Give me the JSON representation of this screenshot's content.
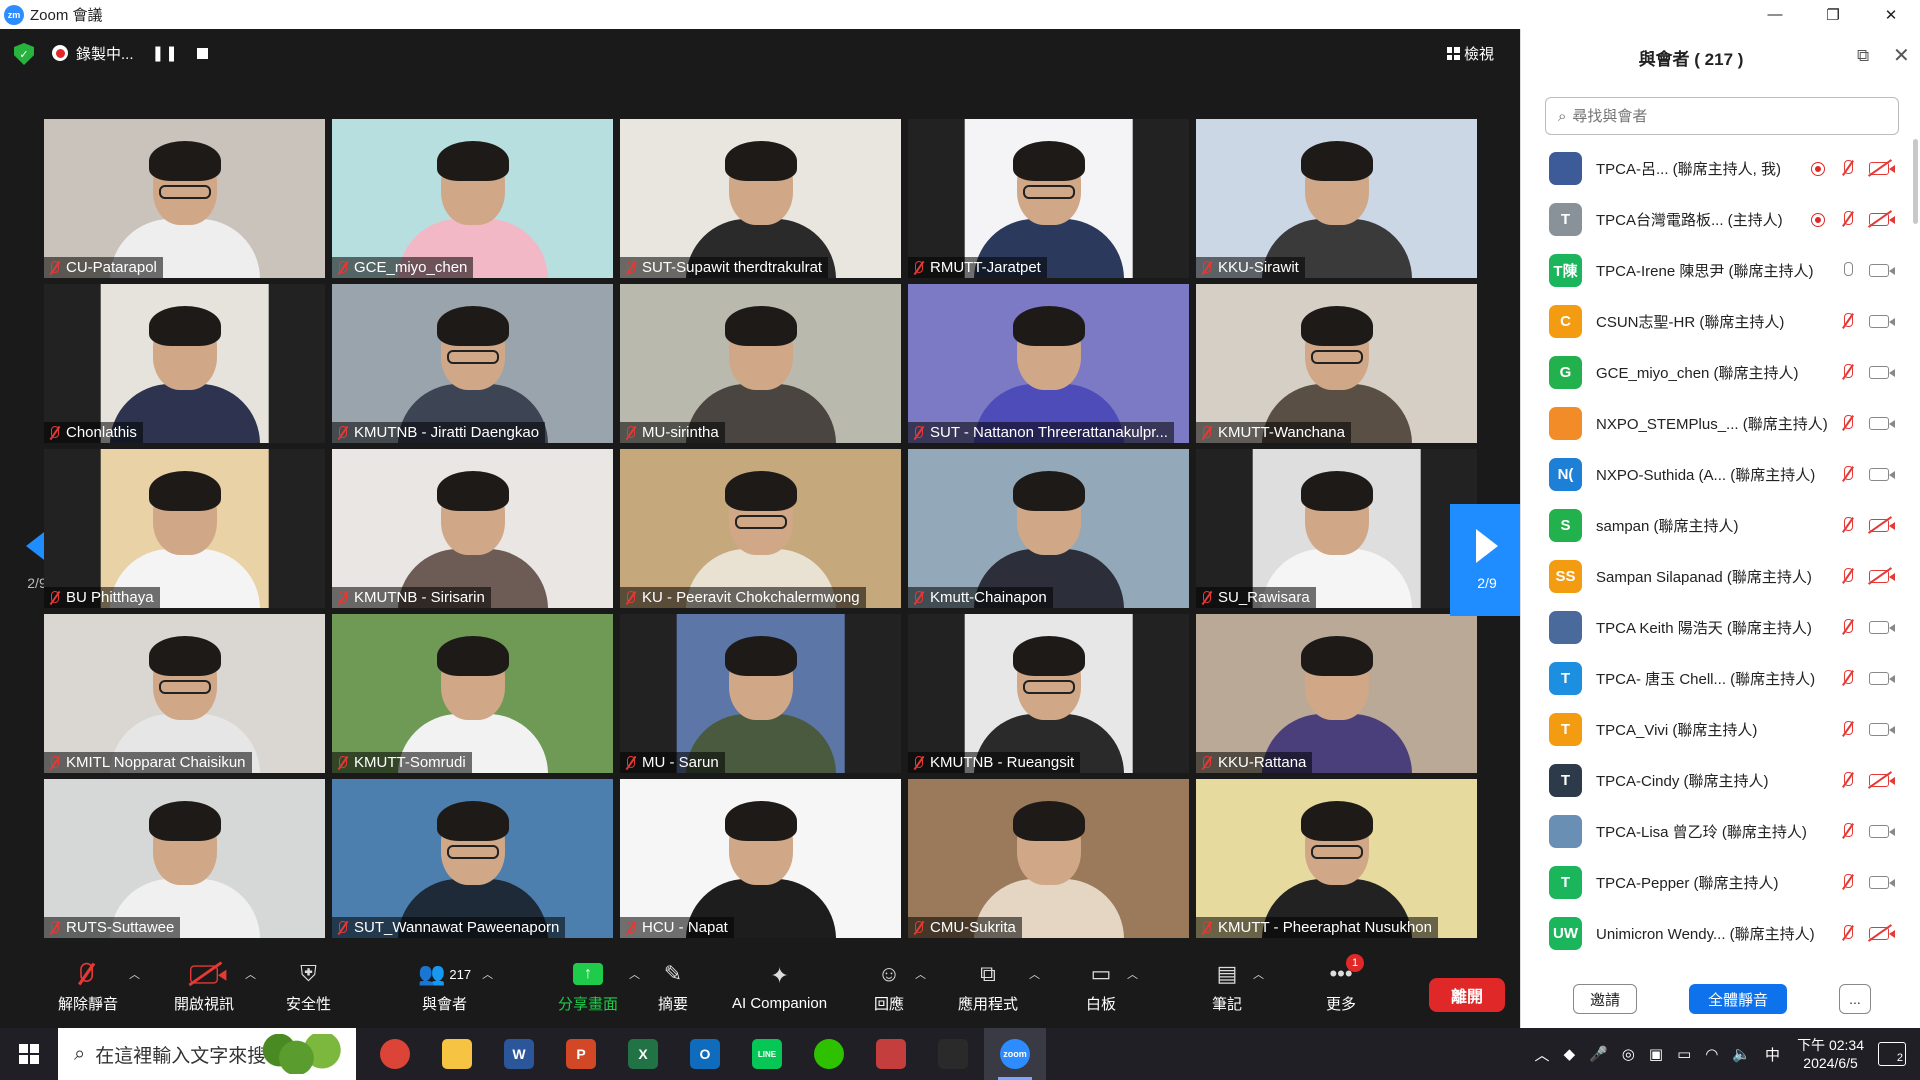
{
  "window": {
    "title": "Zoom 會議",
    "logo_text": "zm"
  },
  "top_controls": {
    "recording_label": "錄製中...",
    "pause_glyph": "❚❚",
    "view_label": "檢視"
  },
  "pagination": {
    "left_page": "2/9",
    "right_page": "2/9"
  },
  "tiles": [
    {
      "name": "CU-Patarapol",
      "bg": "#c9c3bb",
      "shirt": "#eeeeee",
      "narrow": false
    },
    {
      "name": "GCE_miyo_chen",
      "bg": "#b8dfe0",
      "shirt": "#f2b8c6",
      "narrow": false
    },
    {
      "name": "SUT-Supawit therdtrakulrat",
      "bg": "#e9e6e0",
      "shirt": "#2a2a2a",
      "narrow": false
    },
    {
      "name": "RMUTT-Jaratpet",
      "bg": "#f4f4f6",
      "shirt": "#2b3a5c",
      "narrow": true
    },
    {
      "name": "KKU-Sirawit",
      "bg": "#cbd7e4",
      "shirt": "#3a3a3a",
      "narrow": false
    },
    {
      "name": "Chonlathis",
      "bg": "#e6e3dc",
      "shirt": "#2e3350",
      "narrow": true
    },
    {
      "name": "KMUTNB - Jiratti Daengkao",
      "bg": "#9aa4ad",
      "shirt": "#3d4454",
      "narrow": false
    },
    {
      "name": "MU-sirintha",
      "bg": "#b9b9ad",
      "shirt": "#4a4540",
      "narrow": false
    },
    {
      "name": "SUT - Nattanon Threerattanakulpr...",
      "bg": "#7c7ac4",
      "shirt": "#4e4cb8",
      "narrow": false
    },
    {
      "name": "KMUTT-Wanchana",
      "bg": "#d6cfc6",
      "shirt": "#5a4f44",
      "narrow": false
    },
    {
      "name": "BU Phitthaya",
      "bg": "#e9d2a6",
      "shirt": "#f4f4f4",
      "narrow": true
    },
    {
      "name": "KMUTNB - Sirisarin",
      "bg": "#eae6e4",
      "shirt": "#6d5c55",
      "narrow": false
    },
    {
      "name": "KU - Peeravit Chokchalermwong",
      "bg": "#c5a87c",
      "shirt": "#e9e1d2",
      "narrow": false
    },
    {
      "name": "Kmutt-Chainapon",
      "bg": "#93a9b9",
      "shirt": "#2c2f3a",
      "narrow": false
    },
    {
      "name": "SU_Rawisara",
      "bg": "#dedede",
      "shirt": "#f5f5f5",
      "narrow": true
    },
    {
      "name": "KMITL Nopparat Chaisikun",
      "bg": "#dad7d2",
      "shirt": "#e6e6e6",
      "narrow": false
    },
    {
      "name": "KMUTT-Somrudi",
      "bg": "#6f9a56",
      "shirt": "#f2f2f2",
      "narrow": false
    },
    {
      "name": "MU - Sarun",
      "bg": "#5d76a8",
      "shirt": "#4a5a3e",
      "narrow": true
    },
    {
      "name": "KMUTNB - Rueangsit",
      "bg": "#e7e7e7",
      "shirt": "#2a2a2a",
      "narrow": true
    },
    {
      "name": "KKU-Rattana",
      "bg": "#b9a996",
      "shirt": "#4a3f7a",
      "narrow": false
    },
    {
      "name": "RUTS-Suttawee",
      "bg": "#d6d8d8",
      "shirt": "#f0f0f0",
      "narrow": false
    },
    {
      "name": "SUT_Wannawat Paweenaporn",
      "bg": "#4d7fae",
      "shirt": "#1e2a38",
      "narrow": false
    },
    {
      "name": "HCU - Napat",
      "bg": "#f6f6f6",
      "shirt": "#1d1d1d",
      "narrow": false
    },
    {
      "name": "CMU-Sukrita",
      "bg": "#9a7a5a",
      "shirt": "#e4d6c2",
      "narrow": false
    },
    {
      "name": "KMUTT - Pheeraphat Nusukhon",
      "bg": "#e7da9e",
      "shirt": "#222222",
      "narrow": false
    }
  ],
  "toolbar": {
    "unmute": "解除靜音",
    "video": "開啟視訊",
    "security": "安全性",
    "participants": "與會者",
    "participants_count": "217",
    "share": "分享畫面",
    "summary": "摘要",
    "ai": "AI Companion",
    "reactions": "回應",
    "apps": "應用程式",
    "whiteboard": "白板",
    "notes": "筆記",
    "more": "更多",
    "more_badge": "1",
    "leave": "離開"
  },
  "panel": {
    "title": "與會者 ( 217 )",
    "search_placeholder": "尋找與會者",
    "invite": "邀請",
    "mute_all": "全體靜音",
    "more": "...",
    "participants": [
      {
        "label": "TPCA-呂...  (聯席主持人, 我)",
        "avatar": "",
        "color": "#3d5a99",
        "rec": true,
        "mic_on": false,
        "cam_on": false
      },
      {
        "label": "TPCA台灣電路板...  (主持人)",
        "avatar": "T",
        "color": "#8a9299",
        "rec": true,
        "mic_on": false,
        "cam_on": false
      },
      {
        "label": "TPCA-Irene 陳思尹 (聯席主持人)",
        "avatar": "T陳",
        "color": "#1bb55c",
        "rec": false,
        "mic_on": true,
        "cam_on": true
      },
      {
        "label": "CSUN志聖-HR (聯席主持人)",
        "avatar": "C",
        "color": "#f39c12",
        "rec": false,
        "mic_on": false,
        "cam_on": true
      },
      {
        "label": "GCE_miyo_chen (聯席主持人)",
        "avatar": "G",
        "color": "#22b14c",
        "rec": false,
        "mic_on": false,
        "cam_on": true
      },
      {
        "label": "NXPO_STEMPlus_...  (聯席主持人)",
        "avatar": "",
        "color": "#f28c28",
        "rec": false,
        "mic_on": false,
        "cam_on": true
      },
      {
        "label": "NXPO-Suthida (A...  (聯席主持人)",
        "avatar": "N(",
        "color": "#1d7fd6",
        "rec": false,
        "mic_on": false,
        "cam_on": true
      },
      {
        "label": "sampan (聯席主持人)",
        "avatar": "S",
        "color": "#22b14c",
        "rec": false,
        "mic_on": false,
        "cam_on": false
      },
      {
        "label": "Sampan Silapanad (聯席主持人)",
        "avatar": "SS",
        "color": "#f39c12",
        "rec": false,
        "mic_on": false,
        "cam_on": false
      },
      {
        "label": "TPCA Keith 陽浩天 (聯席主持人)",
        "avatar": "",
        "color": "#4a6a9c",
        "rec": false,
        "mic_on": false,
        "cam_on": true
      },
      {
        "label": "TPCA- 唐玉 Chell...  (聯席主持人)",
        "avatar": "T",
        "color": "#1d8fe0",
        "rec": false,
        "mic_on": false,
        "cam_on": true
      },
      {
        "label": "TPCA_Vivi (聯席主持人)",
        "avatar": "T",
        "color": "#f39c12",
        "rec": false,
        "mic_on": false,
        "cam_on": true
      },
      {
        "label": "TPCA-Cindy (聯席主持人)",
        "avatar": "T",
        "color": "#2d3a4a",
        "rec": false,
        "mic_on": false,
        "cam_on": false
      },
      {
        "label": "TPCA-Lisa 曾乙玲 (聯席主持人)",
        "avatar": "",
        "color": "#6a8fb5",
        "rec": false,
        "mic_on": false,
        "cam_on": true
      },
      {
        "label": "TPCA-Pepper (聯席主持人)",
        "avatar": "T",
        "color": "#1bb55c",
        "rec": false,
        "mic_on": false,
        "cam_on": true
      },
      {
        "label": "Unimicron Wendy...  (聯席主持人)",
        "avatar": "UW",
        "color": "#1bb55c",
        "rec": false,
        "mic_on": false,
        "cam_on": false
      }
    ]
  },
  "taskbar": {
    "search_placeholder": "在這裡輸入文字來搜尋",
    "time": "下午 02:34",
    "date": "2024/6/5",
    "ime": "中",
    "notifications": "2",
    "apps": [
      {
        "name": "chrome",
        "label": "",
        "color": "#db4437"
      },
      {
        "name": "file-explorer",
        "label": "",
        "color": "#f6c343"
      },
      {
        "name": "word",
        "label": "W",
        "color": "#2b579a"
      },
      {
        "name": "powerpoint",
        "label": "P",
        "color": "#d24726"
      },
      {
        "name": "excel",
        "label": "X",
        "color": "#217346"
      },
      {
        "name": "outlook",
        "label": "O",
        "color": "#0f6cbd"
      },
      {
        "name": "line",
        "label": "LINE",
        "color": "#06c755"
      },
      {
        "name": "wechat",
        "label": "",
        "color": "#2dc100"
      },
      {
        "name": "snipping",
        "label": "",
        "color": "#c43e3e"
      },
      {
        "name": "terminal",
        "label": "",
        "color": "#2a2a2a"
      },
      {
        "name": "zoom",
        "label": "zoom",
        "color": "#2d8cff"
      }
    ]
  }
}
